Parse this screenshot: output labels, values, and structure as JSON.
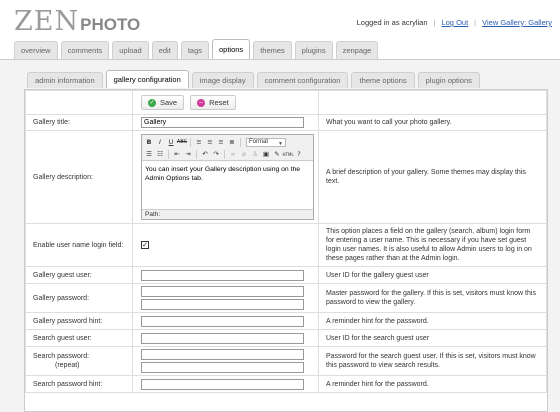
{
  "header": {
    "logo_zen": "ZEN",
    "logo_photo": "PHOTO",
    "logged_in_text": "Logged in as acrylian",
    "logout_label": "Log Out",
    "view_gallery_label": "View Gallery: Gallery"
  },
  "main_tabs": [
    {
      "label": "overview"
    },
    {
      "label": "comments"
    },
    {
      "label": "upload"
    },
    {
      "label": "edit"
    },
    {
      "label": "tags"
    },
    {
      "label": "options",
      "active": true
    },
    {
      "label": "themes"
    },
    {
      "label": "plugins"
    },
    {
      "label": "zenpage"
    }
  ],
  "sub_tabs": [
    {
      "label": "admin information"
    },
    {
      "label": "gallery configuration",
      "active": true
    },
    {
      "label": "image display"
    },
    {
      "label": "comment configuration"
    },
    {
      "label": "theme options"
    },
    {
      "label": "plugin options"
    }
  ],
  "buttons": {
    "save_label": "Save",
    "reset_label": "Reset"
  },
  "rows": {
    "gallery_title": {
      "label": "Gallery title:",
      "value": "Gallery",
      "desc": "What you want to call your photo gallery."
    },
    "gallery_description": {
      "label": "Gallery description:",
      "editor_text": "You can insert your Gallery description using on the Admin Options tab.",
      "format_label": "Format",
      "path_label": "Path:",
      "desc": "A brief description of your gallery. Some themes may display this text."
    },
    "user_name_login": {
      "label": "Enable user name login field:",
      "checked": true,
      "desc": "This option places a field on the gallery (search, album) login form for entering a user name. This is necessary if you have set guest login user names. It is also useful to allow Admin users to log in on these pages rather than at the Admin login."
    },
    "gallery_guest_user": {
      "label": "Gallery guest user:",
      "value": "",
      "desc": "User ID for the gallery guest user"
    },
    "gallery_password": {
      "label": "Gallery password:",
      "value": "",
      "value_repeat": "",
      "desc": "Master password for the gallery. If this is set, visitors must know this password to view the gallery."
    },
    "gallery_password_hint": {
      "label": "Gallery password hint:",
      "value": "",
      "desc": "A reminder hint for the password."
    },
    "search_guest_user": {
      "label": "Search guest user:",
      "value": "",
      "desc": "User ID for the search guest user"
    },
    "search_password": {
      "label": "Search password:",
      "label_sub": "(repeat)",
      "value": "",
      "value_repeat": "",
      "desc": "Password for the search guest user. If this is set, visitors must know this password to view search results."
    },
    "search_password_hint": {
      "label": "Search password hint:",
      "value": "",
      "desc": "A reminder hint for the password."
    }
  }
}
